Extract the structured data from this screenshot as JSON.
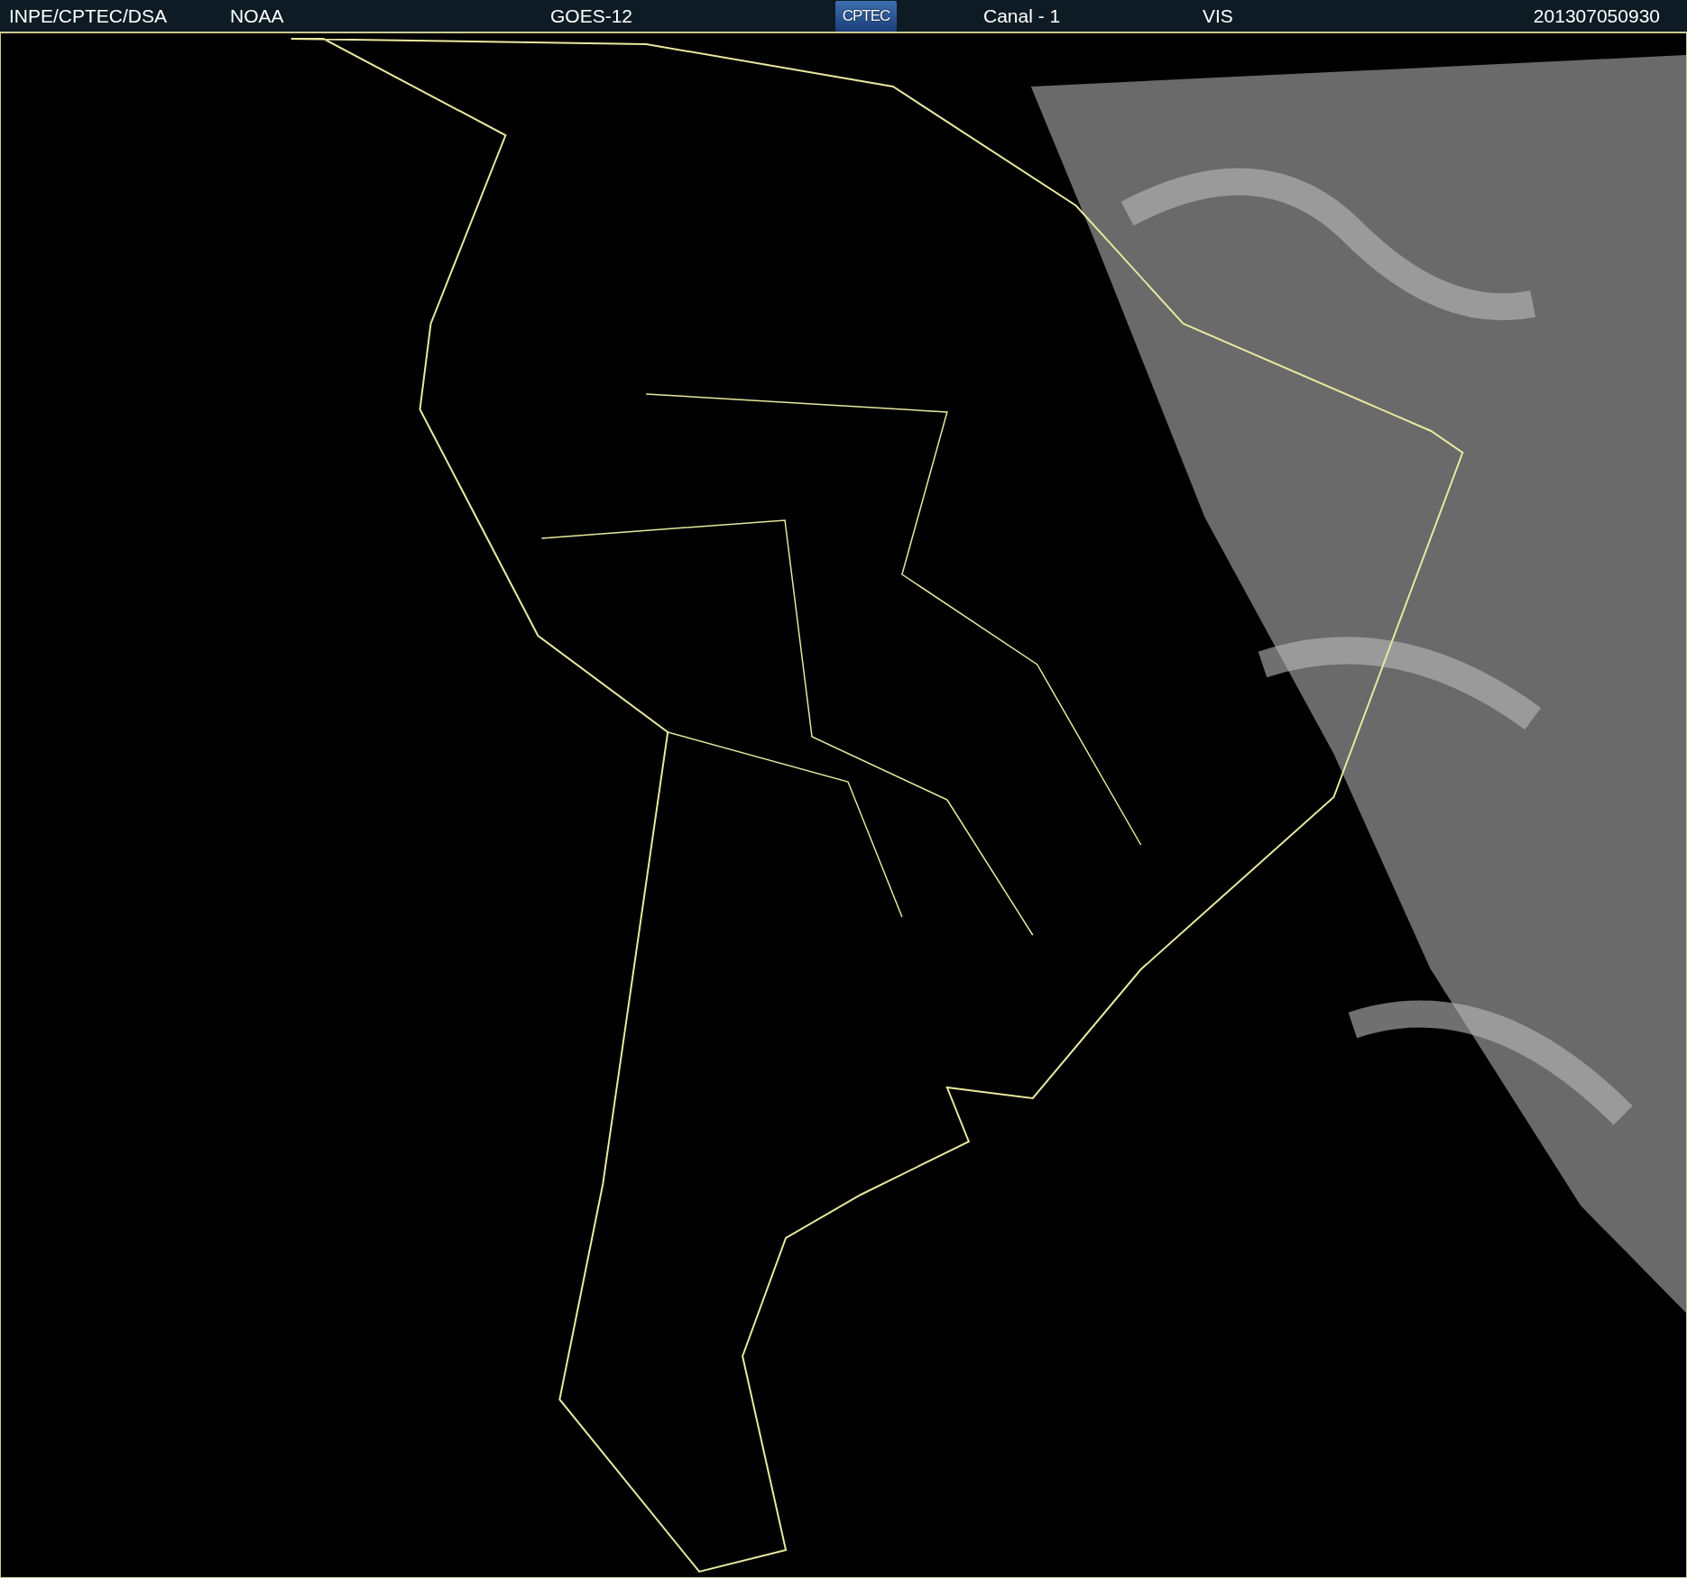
{
  "header": {
    "items": [
      {
        "kind": "text",
        "text": "INPE/CPTEC/DSA"
      },
      {
        "kind": "text",
        "text": "NOAA"
      },
      {
        "kind": "text",
        "text": "GOES-12"
      },
      {
        "kind": "logo",
        "text": "CPTEC"
      },
      {
        "kind": "text",
        "text": "Canal - 1"
      },
      {
        "kind": "text",
        "text": "VIS"
      },
      {
        "kind": "text",
        "text": "201307050930"
      }
    ]
  }
}
